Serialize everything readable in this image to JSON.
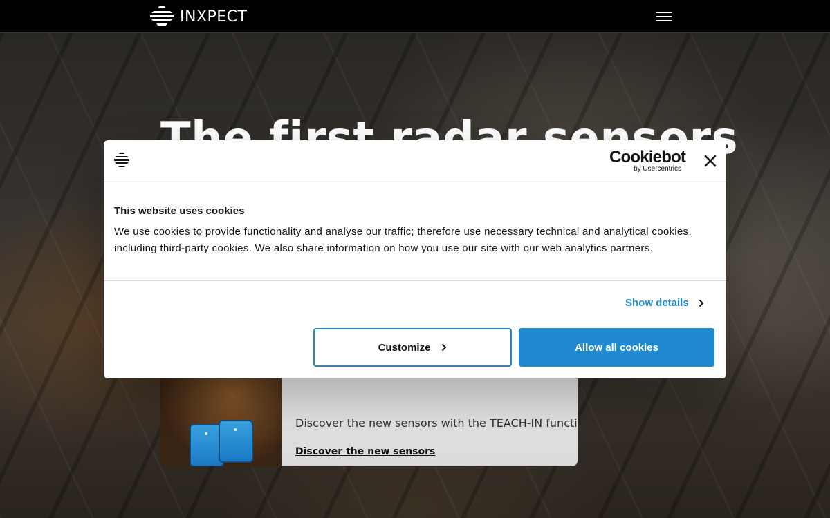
{
  "header": {
    "brand": "INXPECT",
    "logo_icon": "inxpect-logo-icon",
    "menu_icon": "hamburger-menu-icon"
  },
  "hero": {
    "title": "The first radar sensors",
    "promo": {
      "text": "Discover the new sensors with the TEACH-IN function.",
      "link": "Discover the new sensors"
    }
  },
  "cookie_dialog": {
    "provider_name": "Cookiebot",
    "provider_sub": "by Usercentrics",
    "title": "This website uses cookies",
    "body": "We use cookies to provide functionality and analyse our traffic; therefore use necessary technical and analytical cookies, including third-party cookies. We also share information on how you use our site with our web analytics partners.",
    "show_details": "Show details",
    "customize": "Customize",
    "allow_all": "Allow all cookies",
    "accent_color": "#1f8ad0"
  }
}
